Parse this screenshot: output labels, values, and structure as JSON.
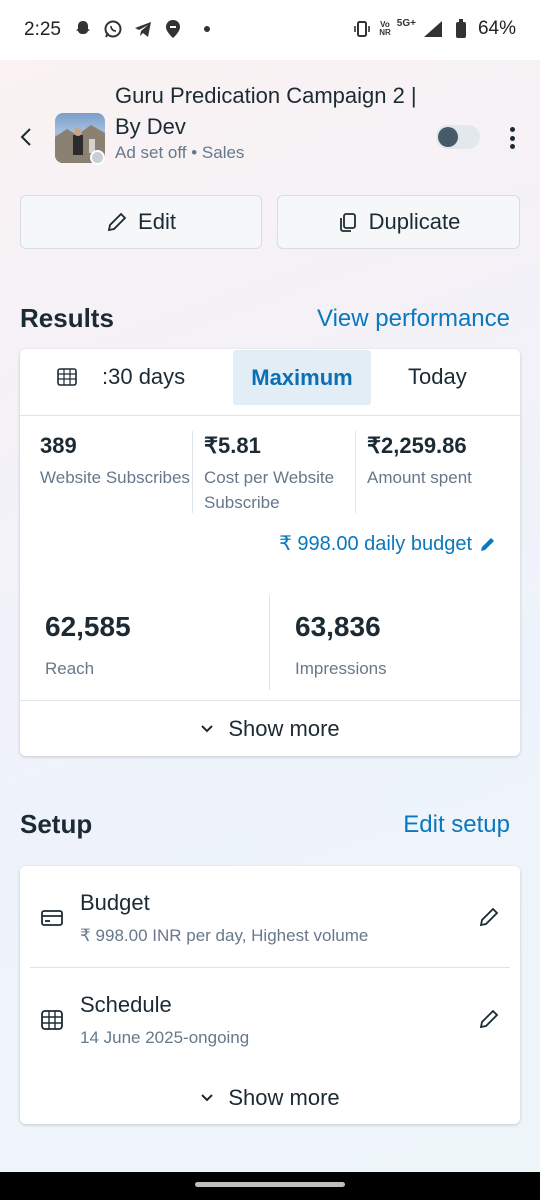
{
  "status_bar": {
    "time": "2:25",
    "volte": "Vo)\nNR",
    "network": "5G+",
    "battery": "64%",
    "icons": [
      "snapchat-icon",
      "whatsapp-icon",
      "telegram-icon",
      "swiggy-icon"
    ]
  },
  "header": {
    "title": "Guru Predication Campaign 2 | By Dev",
    "subtitle": "Ad set off • Sales",
    "toggle_on": false
  },
  "actions": {
    "edit_label": "Edit",
    "duplicate_label": "Duplicate"
  },
  "results": {
    "title": "Results",
    "link": "View performance",
    "ranges": [
      ":30 days",
      "Maximum",
      "Today"
    ],
    "selected_range": "Maximum",
    "metrics": [
      {
        "value": "389",
        "label": "Website Subscribes"
      },
      {
        "value": "₹5.81",
        "label": "Cost per Website Subscribe"
      },
      {
        "value": "₹2,259.86",
        "label": "Amount spent"
      }
    ],
    "budget_link": "₹ 998.00 daily budget",
    "reach": {
      "value": "62,585",
      "label": "Reach"
    },
    "impressions": {
      "value": "63,836",
      "label": "Impressions"
    },
    "show_more": "Show more"
  },
  "setup": {
    "title": "Setup",
    "link": "Edit setup",
    "budget": {
      "title": "Budget",
      "detail": "₹ 998.00 INR per day, Highest volume"
    },
    "schedule": {
      "title": "Schedule",
      "detail": "14 June 2025-ongoing"
    },
    "show_more": "Show more"
  },
  "colors": {
    "accent": "#0a78be",
    "text": "#1c2b33",
    "muted": "#67788a",
    "selected_bg": "#e2edf6"
  }
}
